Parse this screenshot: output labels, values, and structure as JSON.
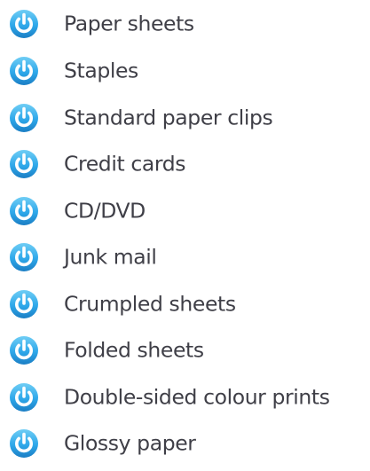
{
  "colors": {
    "icon_light": "#5dc3f2",
    "icon_mid": "#2aa5e8",
    "icon_dark": "#1b7ec4",
    "icon_glyph": "#ffffff",
    "label_text": "#3f3f47"
  },
  "icon": "power-icon",
  "items": [
    {
      "label": "Paper sheets"
    },
    {
      "label": "Staples"
    },
    {
      "label": "Standard paper clips"
    },
    {
      "label": "Credit cards"
    },
    {
      "label": "CD/DVD"
    },
    {
      "label": "Junk mail"
    },
    {
      "label": "Crumpled sheets"
    },
    {
      "label": "Folded sheets"
    },
    {
      "label": "Double-sided colour prints"
    },
    {
      "label": "Glossy paper"
    }
  ]
}
